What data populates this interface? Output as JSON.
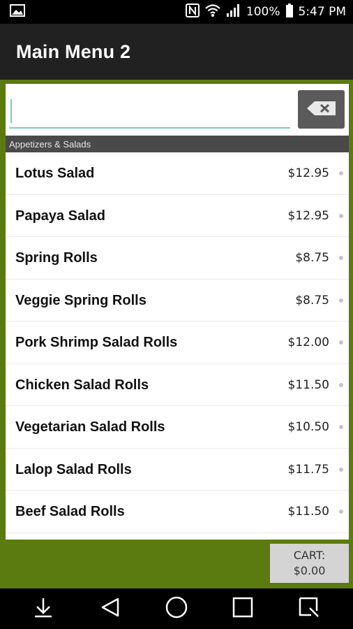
{
  "status_bar": {
    "battery_text": "100%",
    "time": "5:47 PM",
    "icons": [
      "image-icon",
      "nfc-icon",
      "wifi-icon",
      "signal-icon",
      "battery-icon"
    ]
  },
  "app_bar": {
    "title": "Main Menu 2"
  },
  "search": {
    "value": "",
    "placeholder": "",
    "clear_icon": "backspace-icon"
  },
  "section": {
    "title": "Appetizers & Salads"
  },
  "menu_items": [
    {
      "name": "Lotus Salad",
      "price": "$12.95"
    },
    {
      "name": "Papaya Salad",
      "price": "$12.95"
    },
    {
      "name": "Spring Rolls",
      "price": "$8.75"
    },
    {
      "name": "Veggie Spring Rolls",
      "price": "$8.75"
    },
    {
      "name": "Pork Shrimp Salad Rolls",
      "price": "$12.00"
    },
    {
      "name": "Chicken Salad Rolls",
      "price": "$11.50"
    },
    {
      "name": "Vegetarian Salad Rolls",
      "price": "$10.50"
    },
    {
      "name": "Lalop Salad Rolls",
      "price": "$11.75"
    },
    {
      "name": "Beef Salad Rolls",
      "price": "$11.50"
    }
  ],
  "cart": {
    "label": "CART:",
    "total": "$0.00"
  },
  "nav_bar": {
    "icons": [
      "notification-pull-icon",
      "back-icon",
      "home-icon",
      "recents-icon",
      "qslide-icon"
    ]
  },
  "colors": {
    "background": "#5b7a0f",
    "app_bar": "#212121",
    "accent": "#80cbc4",
    "section_header": "#4a4a4a",
    "cart_button": "#d4d4d4"
  }
}
